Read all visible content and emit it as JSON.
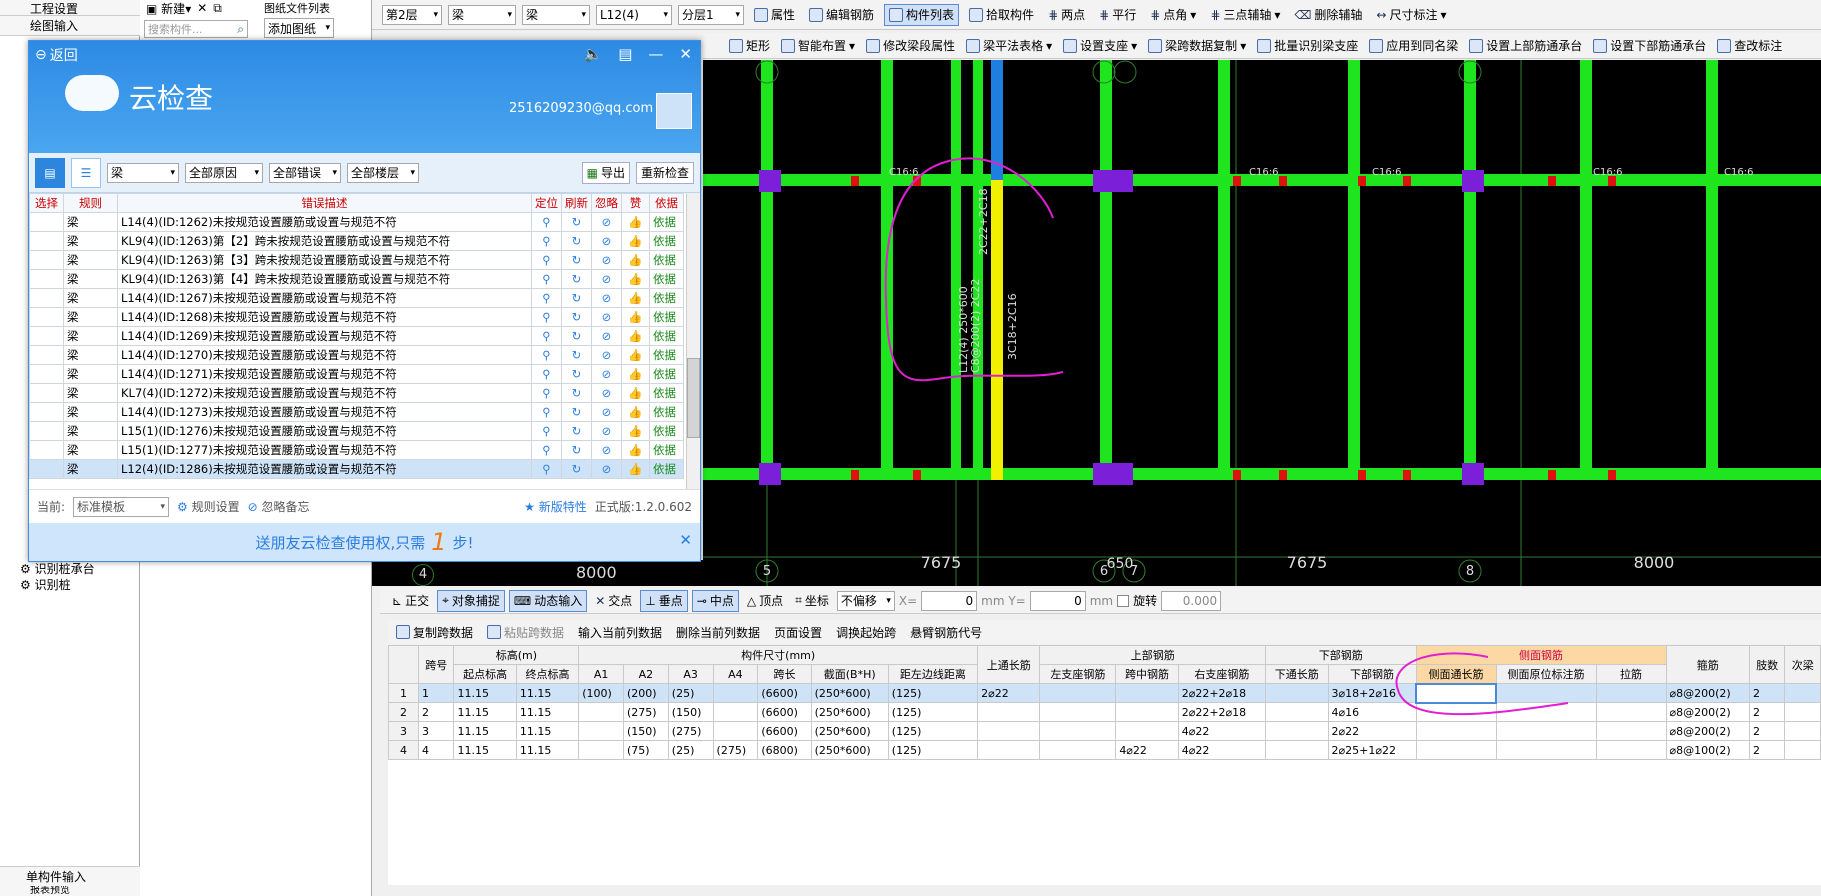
{
  "left_panel": {
    "top_items": [
      "工程设置",
      "绘图输入"
    ],
    "bottom_items": [
      "识别桩承台",
      "识别桩"
    ],
    "footer": "单构件输入",
    "footer2": "报表预览"
  },
  "mid_panel": {
    "new_label": "新建",
    "search_placeholder": "搜索构件...",
    "file_list": "图纸文件列表",
    "add_drawing": "添加图纸"
  },
  "toolbar1": {
    "floor": "第2层",
    "type1": "梁",
    "type2": "梁",
    "component": "L12(4)",
    "sublayer": "分层1",
    "items": [
      "属性",
      "编辑钢筋",
      "构件列表",
      "拾取构件",
      "两点",
      "平行",
      "点角",
      "三点辅轴",
      "删除辅轴",
      "尺寸标注"
    ]
  },
  "toolbar2": {
    "items": [
      "矩形",
      "智能布置",
      "修改梁段属性",
      "梁平法表格",
      "设置支座",
      "梁跨数据复制",
      "批量识别梁支座",
      "应用到同名梁",
      "设置上部筋通承台",
      "设置下部筋通承台",
      "查改标注"
    ]
  },
  "dialog": {
    "back": "返回",
    "title": "云检查",
    "email": "2516209230@qq.com",
    "filter_type": "梁",
    "filter_reason": "全部原因",
    "filter_error": "全部错误",
    "filter_floor": "全部楼层",
    "export": "导出",
    "recheck": "重新检查",
    "headers": [
      "选择",
      "规则",
      "错误描述",
      "定位",
      "刷新",
      "忽略",
      "赞",
      "依据"
    ],
    "rows": [
      {
        "rule": "梁",
        "desc": "L14(4)(ID:1262)未按规范设置腰筋或设置与规范不符",
        "basis": "依据"
      },
      {
        "rule": "梁",
        "desc": "KL9(4)(ID:1263)第【2】跨未按规范设置腰筋或设置与规范不符",
        "basis": "依据"
      },
      {
        "rule": "梁",
        "desc": "KL9(4)(ID:1263)第【3】跨未按规范设置腰筋或设置与规范不符",
        "basis": "依据"
      },
      {
        "rule": "梁",
        "desc": "KL9(4)(ID:1263)第【4】跨未按规范设置腰筋或设置与规范不符",
        "basis": "依据"
      },
      {
        "rule": "梁",
        "desc": "L14(4)(ID:1267)未按规范设置腰筋或设置与规范不符",
        "basis": "依据"
      },
      {
        "rule": "梁",
        "desc": "L14(4)(ID:1268)未按规范设置腰筋或设置与规范不符",
        "basis": "依据"
      },
      {
        "rule": "梁",
        "desc": "L14(4)(ID:1269)未按规范设置腰筋或设置与规范不符",
        "basis": "依据"
      },
      {
        "rule": "梁",
        "desc": "L14(4)(ID:1270)未按规范设置腰筋或设置与规范不符",
        "basis": "依据"
      },
      {
        "rule": "梁",
        "desc": "L14(4)(ID:1271)未按规范设置腰筋或设置与规范不符",
        "basis": "依据"
      },
      {
        "rule": "梁",
        "desc": "KL7(4)(ID:1272)未按规范设置腰筋或设置与规范不符",
        "basis": "依据"
      },
      {
        "rule": "梁",
        "desc": "L14(4)(ID:1273)未按规范设置腰筋或设置与规范不符",
        "basis": "依据"
      },
      {
        "rule": "梁",
        "desc": "L15(1)(ID:1276)未按规范设置腰筋或设置与规范不符",
        "basis": "依据"
      },
      {
        "rule": "梁",
        "desc": "L15(1)(ID:1277)未按规范设置腰筋或设置与规范不符",
        "basis": "依据"
      },
      {
        "rule": "梁",
        "desc": "L12(4)(ID:1286)未按规范设置腰筋或设置与规范不符",
        "basis": "依据"
      }
    ],
    "current_label": "当前:",
    "template": "标准模板",
    "rule_settings": "规则设置",
    "ignore_memo": "忽略备忘",
    "new_feature": "新版特性",
    "version": "正式版:1.2.0.602",
    "promo_pre": "送朋友云检查使用权,只需",
    "promo_num": "1",
    "promo_post": "步!"
  },
  "cad": {
    "axis_labels": [
      "4",
      "5",
      "6",
      "7",
      "8"
    ],
    "dims": [
      "8000",
      "7675",
      "650",
      "7675",
      "8000"
    ],
    "beam_text1": "2C22+2C18",
    "beam_text2": "L12(4) 250*600",
    "beam_text3": "C8@200(2) 2C22",
    "beam_text4": "3C18+2C16",
    "small_label": "C16:6"
  },
  "statusbar": {
    "items": [
      "正交",
      "对象捕捉",
      "动态输入",
      "交点",
      "垂点",
      "中点",
      "顶点",
      "坐标"
    ],
    "offset": "不偏移",
    "x_label": "X=",
    "x_val": "0",
    "y_label": "mm Y=",
    "y_val": "0",
    "mm": "mm",
    "rotate": "旋转",
    "rotate_val": "0.000"
  },
  "grid_toolbar": {
    "items": [
      "复制跨数据",
      "粘贴跨数据",
      "输入当前列数据",
      "删除当前列数据",
      "页面设置",
      "调换起始跨",
      "悬臂钢筋代号"
    ]
  },
  "grid": {
    "group_headers": [
      "标高(m)",
      "构件尺寸(mm)",
      "上部钢筋",
      "下部钢筋",
      "侧面钢筋"
    ],
    "headers": [
      "跨号",
      "起点标高",
      "终点标高",
      "A1",
      "A2",
      "A3",
      "A4",
      "跨长",
      "截面(B*H)",
      "距左边线距离",
      "上通长筋",
      "左支座钢筋",
      "跨中钢筋",
      "右支座钢筋",
      "下通长筋",
      "下部钢筋",
      "侧面通长筋",
      "侧面原位标注筋",
      "拉筋",
      "箍筋",
      "肢数",
      "次梁"
    ],
    "rows": [
      [
        "1",
        "1",
        "11.15",
        "11.15",
        "(100)",
        "(200)",
        "(25)",
        "",
        "(6600)",
        "(250*600)",
        "(125)",
        "2⌀22",
        "",
        "",
        "2⌀22+2⌀18",
        "",
        "3⌀18+2⌀16",
        "",
        "",
        "",
        "⌀8@200(2)",
        "2",
        ""
      ],
      [
        "2",
        "2",
        "11.15",
        "11.15",
        "",
        "(275)",
        "(150)",
        "",
        "(6600)",
        "(250*600)",
        "(125)",
        "",
        "",
        "",
        "2⌀22+2⌀18",
        "",
        "4⌀16",
        "",
        "",
        "",
        "⌀8@200(2)",
        "2",
        ""
      ],
      [
        "3",
        "3",
        "11.15",
        "11.15",
        "",
        "(150)",
        "(275)",
        "",
        "(6600)",
        "(250*600)",
        "(125)",
        "",
        "",
        "",
        "4⌀22",
        "",
        "2⌀22",
        "",
        "",
        "",
        "⌀8@200(2)",
        "2",
        ""
      ],
      [
        "4",
        "4",
        "11.15",
        "11.15",
        "",
        "(75)",
        "(25)",
        "(275)",
        "(6800)",
        "(250*600)",
        "(125)",
        "",
        "",
        "4⌀22",
        "4⌀22",
        "",
        "2⌀25+1⌀22",
        "",
        "",
        "",
        "⌀8@100(2)",
        "2",
        ""
      ]
    ]
  }
}
